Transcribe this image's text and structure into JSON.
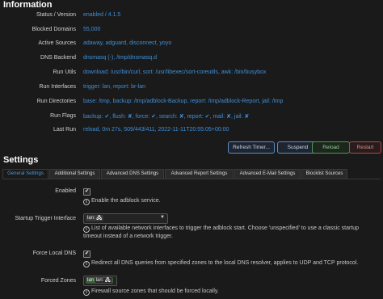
{
  "info": {
    "title": "Information",
    "rows": [
      {
        "label": "Status / Version",
        "value": "enabled / 4.1.5"
      },
      {
        "label": "Blocked Domains",
        "value": "55,000"
      },
      {
        "label": "Active Sources",
        "value": "adaway, adguard, disconnect, yoyo"
      },
      {
        "label": "DNS Backend",
        "value": "dnsmasq (-), /tmp/dnsmasq.d"
      },
      {
        "label": "Run Utils",
        "value": "download: /usr/bin/curl, sort: /usr/libexec/sort-coreutils, awk: /bin/busybox"
      },
      {
        "label": "Run Interfaces",
        "value": "trigger: lan, report: br-lan"
      },
      {
        "label": "Run Directories",
        "value": "base: /tmp, backup: /tmp/adblock-Backup, report: /tmp/adblock-Report, jail: /tmp"
      },
      {
        "label": "Run Flags",
        "value": "backup: ✔, flush: ✘, force: ✔, search: ✘, report: ✔, mail: ✘, jail: ✘"
      },
      {
        "label": "Last Run",
        "value": "reload, 0m 27s, 509/443/411, 2022-11-11T20:55:05+00:00"
      }
    ],
    "buttons": {
      "refresh": "Refresh Timer...",
      "suspend": "Suspend",
      "reload": "Reload",
      "restart": "Restart"
    }
  },
  "settings": {
    "title": "Settings",
    "tabs": [
      "General Settings",
      "Additional Settings",
      "Advanced DNS Settings",
      "Advanced Report Settings",
      "Advanced E-Mail Settings",
      "Blocklist Sources"
    ],
    "enabled": {
      "label": "Enabled",
      "desc": "Enable the adblock service."
    },
    "startup": {
      "label": "Startup Trigger Interface",
      "chip_prefix": "lan:",
      "chip_icon": "🖧",
      "desc": "List of available network interfaces to trigger the adblock start. Choose 'unspecified' to use a classic startup timeout instead of a network trigger."
    },
    "force_dns": {
      "label": "Force Local DNS",
      "desc": "Redirect all DNS queries from specified zones to the local DNS resolver, applies to UDP and TCP protocol."
    },
    "forced_zones": {
      "label": "Forced Zones",
      "chip_zone": "lan",
      "chip_prefix": "lan:",
      "desc": "Firewall source zones that should be forced locally."
    }
  },
  "colors": {
    "accent": "#3f8fd8",
    "background": "#1a1a1a",
    "reload": "#4f9a4f",
    "restart": "#b04848"
  }
}
